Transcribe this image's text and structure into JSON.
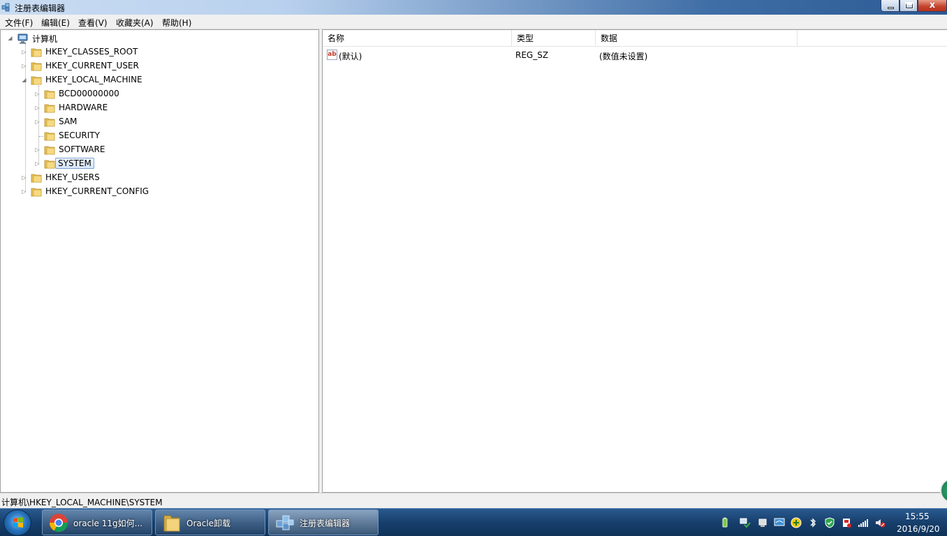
{
  "window": {
    "title": "注册表编辑器",
    "close_glyph": "x"
  },
  "menu": [
    "文件(F)",
    "编辑(E)",
    "查看(V)",
    "收藏夹(A)",
    "帮助(H)"
  ],
  "tree": {
    "root": "计算机",
    "hives": [
      {
        "label": "HKEY_CLASSES_ROOT",
        "expander": "▷"
      },
      {
        "label": "HKEY_CURRENT_USER",
        "expander": "▷"
      },
      {
        "label": "HKEY_LOCAL_MACHINE",
        "expander": "◢"
      },
      {
        "label": "HKEY_USERS",
        "expander": "▷"
      },
      {
        "label": "HKEY_CURRENT_CONFIG",
        "expander": "▷"
      }
    ],
    "hklm_children": [
      {
        "label": "BCD00000000",
        "expander": "▷"
      },
      {
        "label": "HARDWARE",
        "expander": "▷"
      },
      {
        "label": "SAM",
        "expander": "▷"
      },
      {
        "label": "SECURITY",
        "expander": ""
      },
      {
        "label": "SOFTWARE",
        "expander": "▷"
      },
      {
        "label": "SYSTEM",
        "expander": "▷",
        "selected": true
      }
    ],
    "root_expander": "◢"
  },
  "list": {
    "columns": [
      "名称",
      "类型",
      "数据"
    ],
    "rows": [
      {
        "icon": "ab",
        "name": "(默认)",
        "type": "REG_SZ",
        "data": "(数值未设置)"
      }
    ]
  },
  "status": {
    "path": "计算机\\HKEY_LOCAL_MACHINE\\SYSTEM"
  },
  "taskbar": {
    "buttons": [
      {
        "label": "oracle 11g如何...",
        "icon": "chrome-icon"
      },
      {
        "label": "Oracle卸载",
        "icon": "folder-icon"
      },
      {
        "label": "注册表编辑器",
        "icon": "regedit-icon",
        "active": true
      }
    ],
    "tray_icons": [
      "battery-icon",
      "network-check-icon",
      "usb-icon",
      "display-icon",
      "add-icon",
      "bluetooth-icon",
      "shield-icon",
      "security-flag-icon",
      "signal-icon",
      "volume-muted-icon"
    ],
    "time": "15:55",
    "date": "2016/9/20"
  },
  "colors": {
    "selection_border": "#7da2ce",
    "taskbar_bg": "#173f6c",
    "close_red": "#c5402a"
  }
}
